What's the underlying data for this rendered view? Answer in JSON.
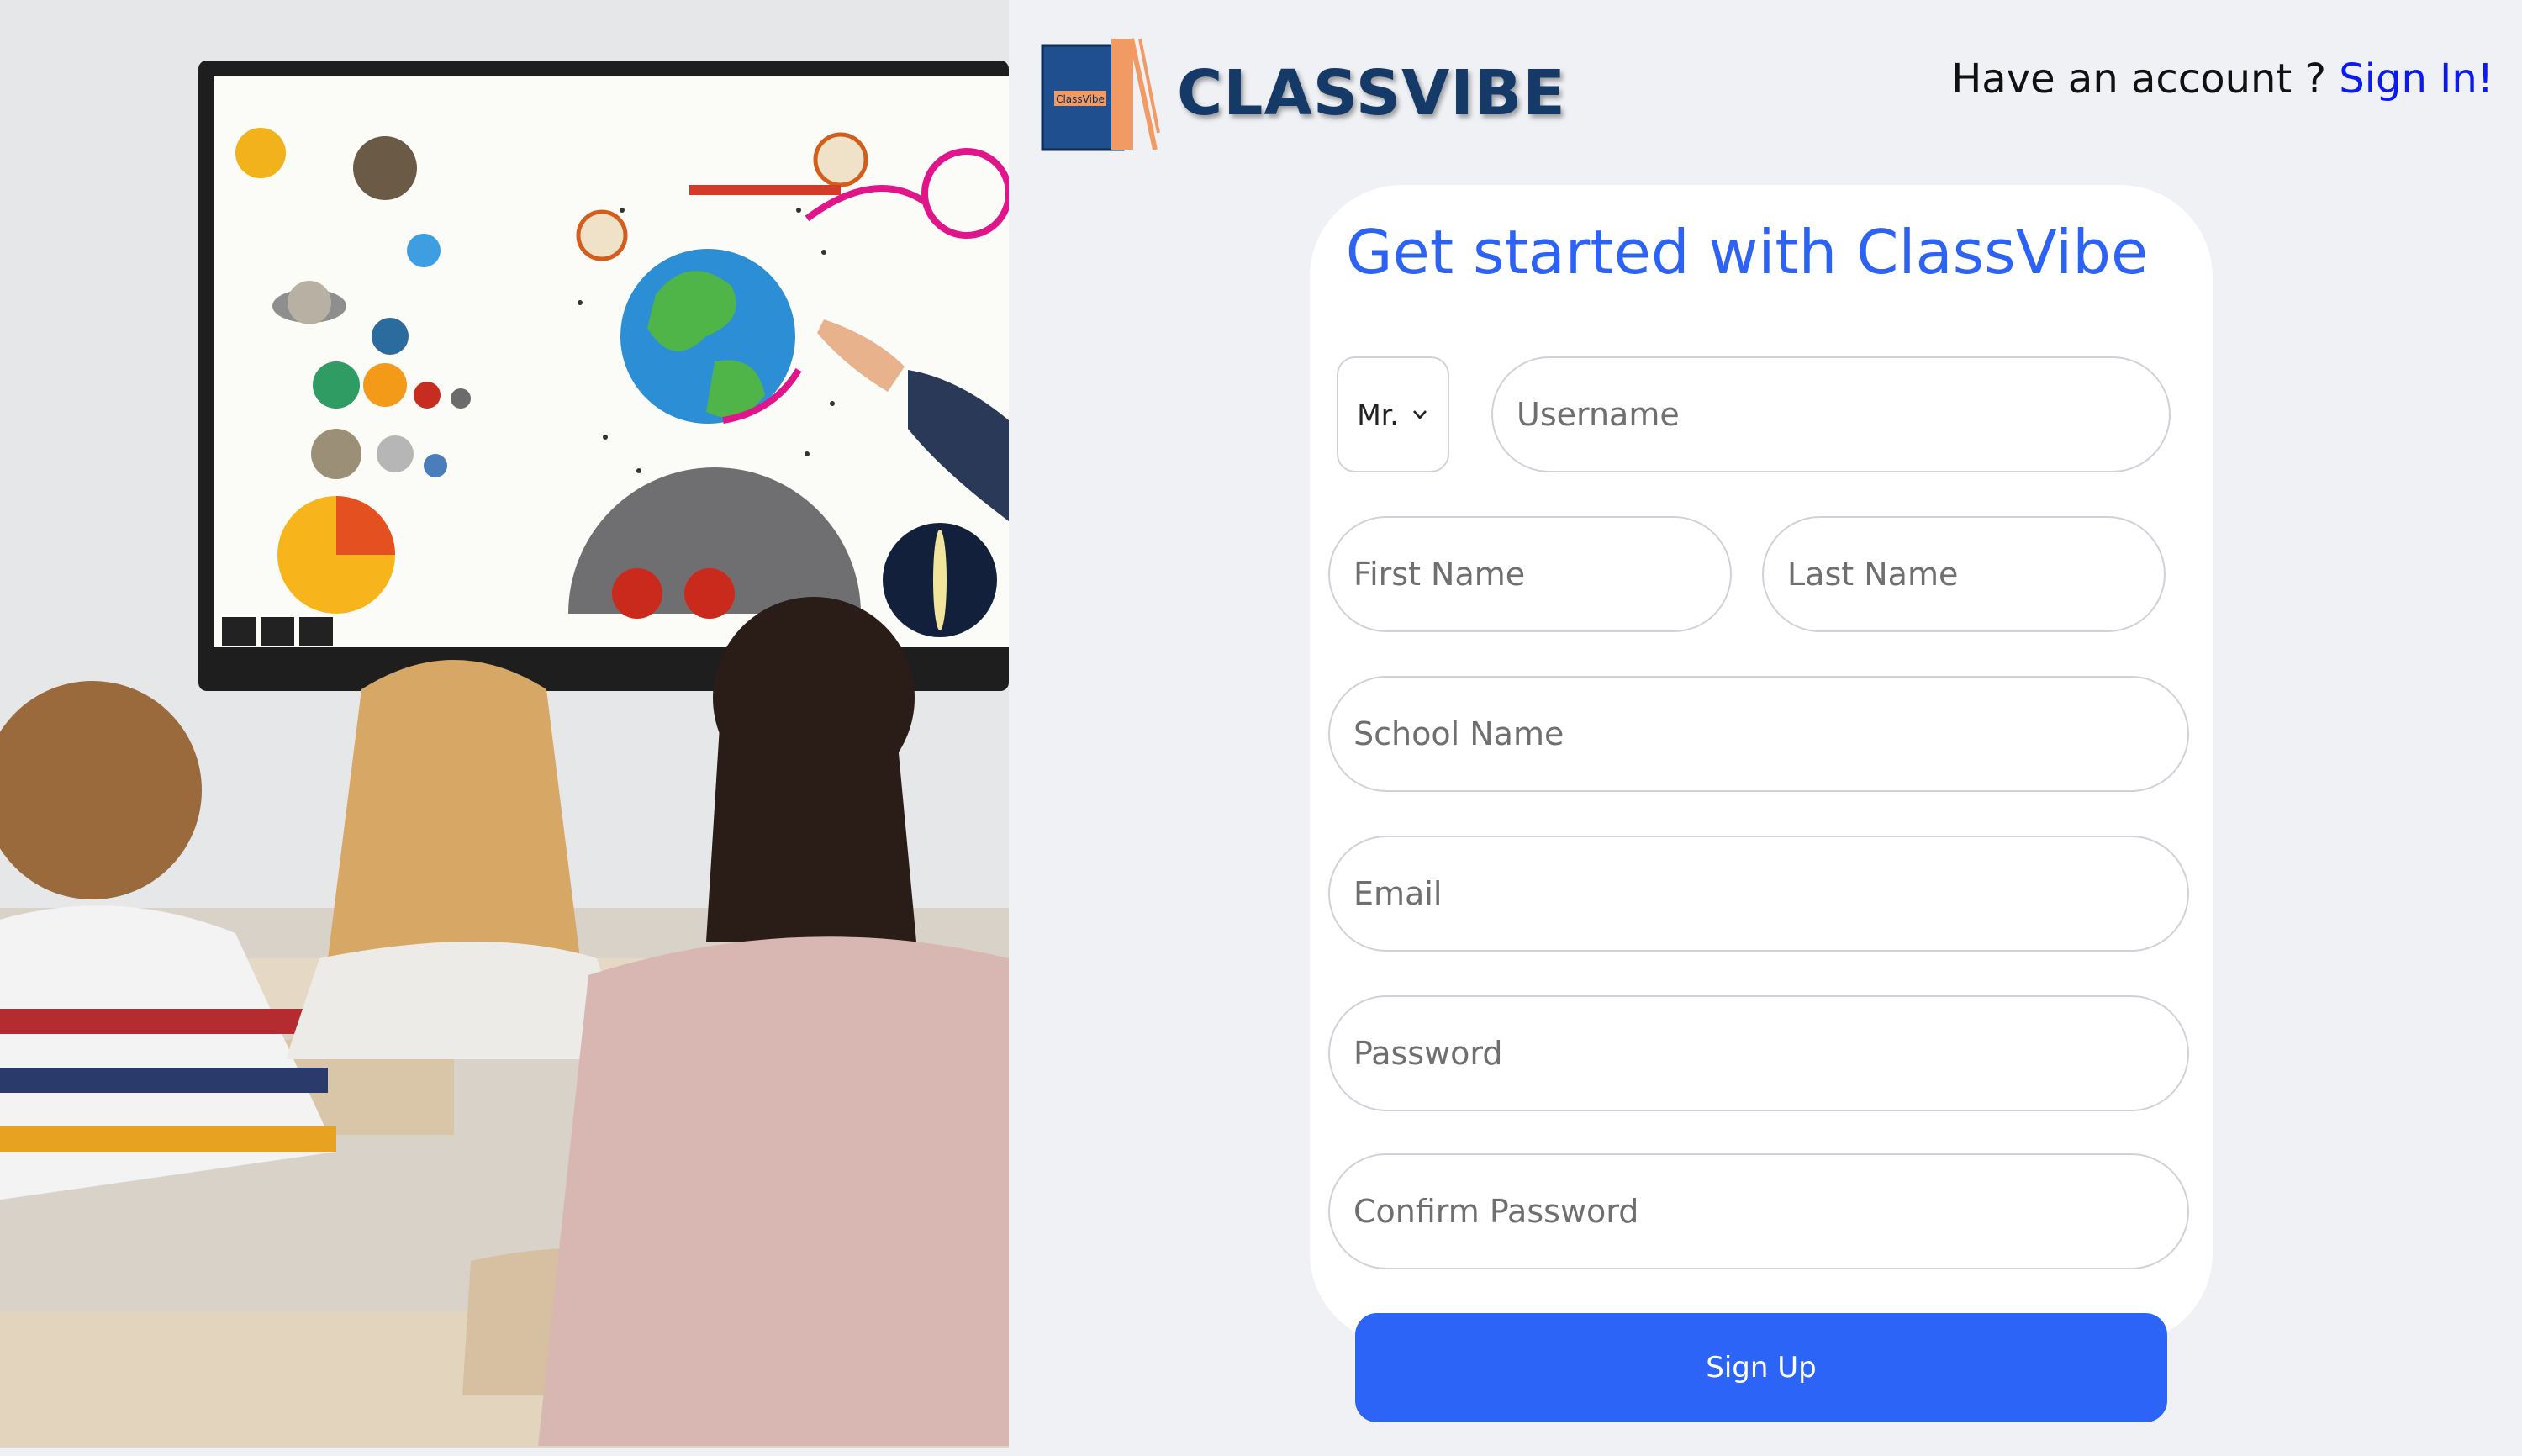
{
  "brand": {
    "logo_text": "ClassVibe",
    "name": "CLASSVIBE"
  },
  "header": {
    "account_prompt": "Have an account ? ",
    "sign_in_label": "Sign In!"
  },
  "form": {
    "title": "Get started with ClassVibe",
    "salutation_value": "Mr.",
    "username_placeholder": "Username",
    "first_name_placeholder": "First Name",
    "last_name_placeholder": "Last Name",
    "school_name_placeholder": "School Name",
    "email_placeholder": "Email",
    "password_placeholder": "Password",
    "confirm_password_placeholder": "Confirm Password",
    "submit_label": "Sign Up"
  },
  "colors": {
    "accent": "#2d63f5",
    "button": "#2b64f7",
    "brand": "#163a67",
    "link": "#0b1bf0",
    "background": "#eff1f5"
  },
  "icons": {
    "logo": "book-logo-icon",
    "salutation_chevron": "chevron-down-icon"
  }
}
